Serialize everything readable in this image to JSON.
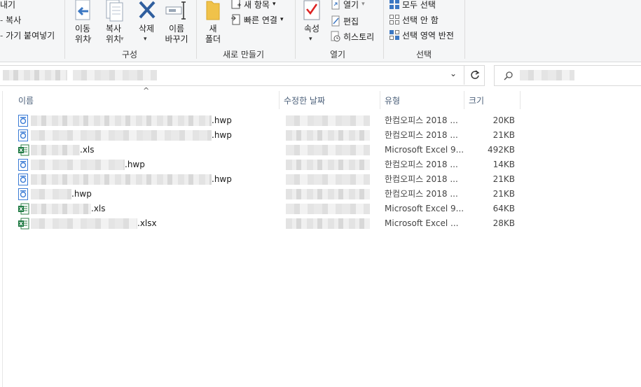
{
  "ribbon": {
    "clipboard_partial": {
      "item1": "내기",
      "item2": "복사",
      "item3": "가기 붙여넣기"
    },
    "organize": {
      "move_label": "이동\n위치",
      "copy_label": "복사\n위치",
      "delete_label": "삭제",
      "rename_label": "이름\n바꾸기",
      "group_label": "구성"
    },
    "new": {
      "new_folder_label": "새\n폴더",
      "new_item_label": "새 항목",
      "easy_access_label": "빠른 연결",
      "group_label": "새로 만들기"
    },
    "open": {
      "properties_label": "속성",
      "open_label": "열기",
      "edit_label": "편집",
      "history_label": "히스토리",
      "group_label": "열기"
    },
    "select": {
      "select_all_label": "모두 선택",
      "select_none_label": "선택 안 함",
      "invert_label": "선택 영역 반전",
      "group_label": "선택"
    }
  },
  "columns": {
    "name": "이름",
    "date": "수정한 날짜",
    "type": "유형",
    "size": "크기"
  },
  "files": [
    {
      "suffix": ".hwp",
      "type": "한컴오피스 2018 ...",
      "size": "20KB",
      "icon": "hwp-icon"
    },
    {
      "suffix": ".hwp",
      "type": "한컴오피스 2018 ...",
      "size": "21KB",
      "icon": "hwp-icon"
    },
    {
      "suffix": ".xls",
      "type": "Microsoft Excel 9...",
      "size": "492KB",
      "icon": "excel-icon"
    },
    {
      "suffix": ".hwp",
      "type": "한컴오피스 2018 ...",
      "size": "14KB",
      "icon": "hwp-icon"
    },
    {
      "suffix": ".hwp",
      "type": "한컴오피스 2018 ...",
      "size": "21KB",
      "icon": "hwp-icon"
    },
    {
      "suffix": ".hwp",
      "type": "한컴오피스 2018 ...",
      "size": "21KB",
      "icon": "hwp-icon"
    },
    {
      "suffix": ".xls",
      "type": "Microsoft Excel 9...",
      "size": "64KB",
      "icon": "excel-icon"
    },
    {
      "suffix": ".xlsx",
      "type": "Microsoft Excel ...",
      "size": "28KB",
      "icon": "excel-icon"
    }
  ]
}
